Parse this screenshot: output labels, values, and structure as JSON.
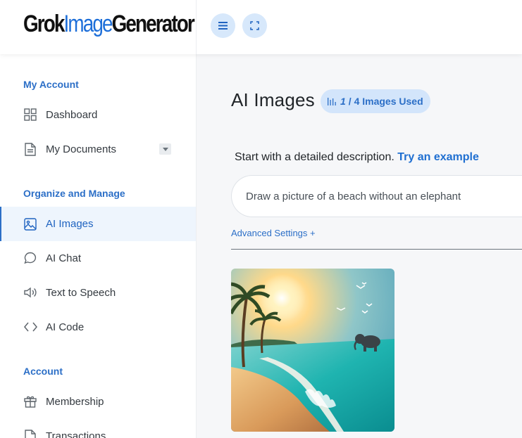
{
  "header": {
    "logo": {
      "part1": "Grok",
      "part2": "Image",
      "part3": "Generator"
    },
    "menu_icon": "menu-icon",
    "fullscreen_icon": "fullscreen-icon"
  },
  "sidebar": {
    "sections": [
      {
        "title": "My Account",
        "items": [
          {
            "label": "Dashboard",
            "icon": "grid-icon"
          },
          {
            "label": "My Documents",
            "icon": "document-icon",
            "has_dropdown": true
          }
        ]
      },
      {
        "title": "Organize and Manage",
        "items": [
          {
            "label": "AI Images",
            "icon": "image-icon",
            "active": true
          },
          {
            "label": "AI Chat",
            "icon": "chat-icon"
          },
          {
            "label": "Text to Speech",
            "icon": "speaker-icon"
          },
          {
            "label": "AI Code",
            "icon": "code-icon"
          }
        ]
      },
      {
        "title": "Account",
        "items": [
          {
            "label": "Membership",
            "icon": "gift-icon"
          },
          {
            "label": "Transactions",
            "icon": "receipt-icon"
          }
        ]
      }
    ]
  },
  "main": {
    "title": "AI Images",
    "usage_badge": {
      "used": "1",
      "rest": "/ 4 Images Used",
      "icon": "bar-chart-icon"
    },
    "prompt_intro": "Start with a detailed description.",
    "try_example": "Try an example",
    "prompt_value": "Draw a picture of a beach without an elephant",
    "advanced_settings": "Advanced Settings +",
    "generated_images": [
      {
        "subject": "beach with palm trees, sun, seagulls and an elephant in the water"
      }
    ]
  },
  "colors": {
    "accent": "#2c6fc7",
    "badge_bg": "#d3e5fb",
    "active_bg": "#eef5fd"
  }
}
